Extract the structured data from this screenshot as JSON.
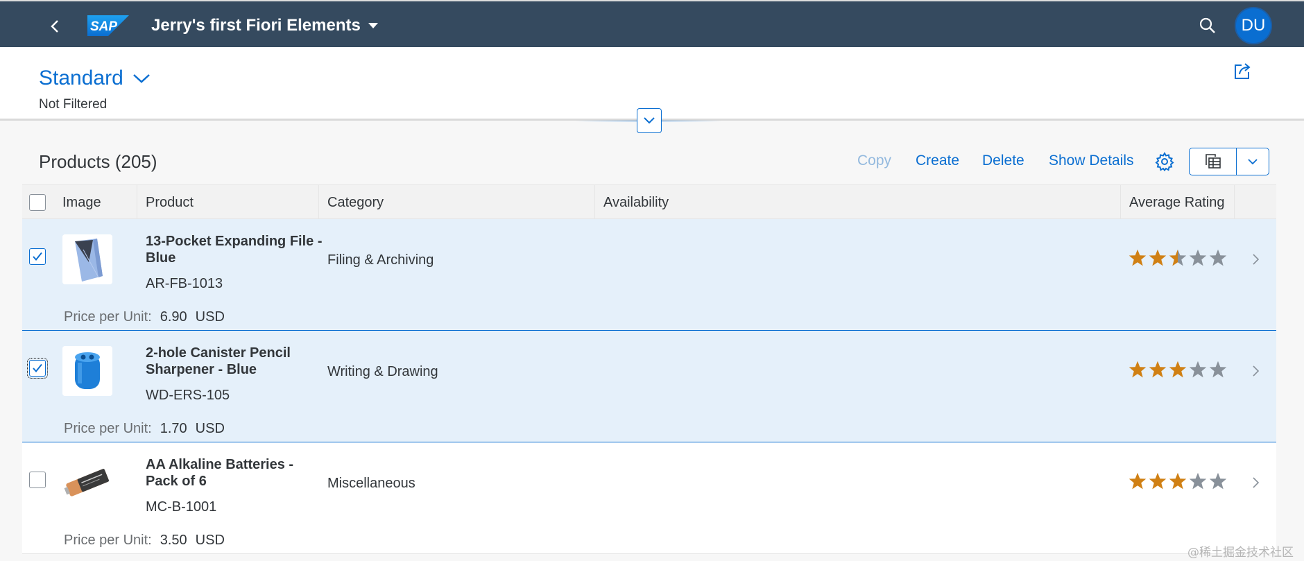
{
  "shell": {
    "logo_text": "SAP",
    "title": "Jerry's first Fiori Elements",
    "avatar_initials": "DU"
  },
  "header": {
    "variant": "Standard",
    "filter_status": "Not Filtered"
  },
  "toolbar": {
    "title": "Products (205)",
    "copy": "Copy",
    "create": "Create",
    "delete": "Delete",
    "show_details": "Show Details"
  },
  "table": {
    "columns": [
      "Image",
      "Product",
      "Category",
      "Availability",
      "Average Rating"
    ],
    "price_label": "Price per Unit:",
    "rows": [
      {
        "name": "13-Pocket Expanding File - Blue",
        "id": "AR-FB-1013",
        "category": "Filing & Archiving",
        "price": "6.90",
        "currency": "USD",
        "rating": 2.5,
        "selected": true,
        "image": "expanding-file-image"
      },
      {
        "name": "2-hole Canister Pencil Sharpener - Blue",
        "id": "WD-ERS-105",
        "category": "Writing & Drawing",
        "price": "1.70",
        "currency": "USD",
        "rating": 3,
        "selected": true,
        "image": "pencil-sharpener-image"
      },
      {
        "name": "AA Alkaline Batteries - Pack of 6",
        "id": "MC-B-1001",
        "category": "Miscellaneous",
        "price": "3.50",
        "currency": "USD",
        "rating": 3,
        "selected": false,
        "image": "batteries-image"
      }
    ]
  },
  "watermark": "@稀土掘金技术社区",
  "colors": {
    "shell": "#354a5f",
    "accent": "#0a6ed1",
    "star_filled": "#d08014",
    "star_empty": "#89919a",
    "row_selected": "#e5f0fa"
  }
}
